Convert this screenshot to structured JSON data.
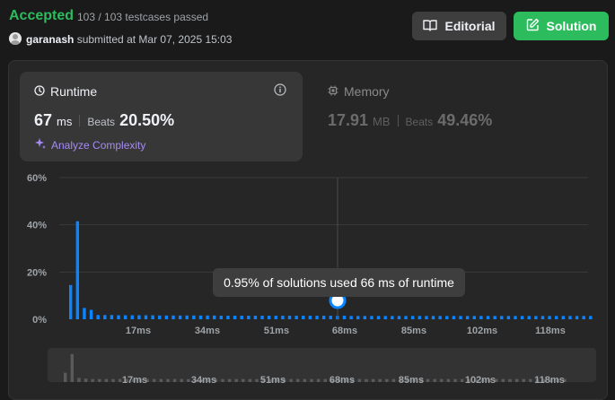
{
  "header": {
    "status": "Accepted",
    "testcases": "103 / 103 testcases passed",
    "username": "garanash",
    "submitted_text": "submitted at Mar 07, 2025 15:03",
    "editorial_label": "Editorial",
    "solution_label": "Solution"
  },
  "runtime": {
    "title": "Runtime",
    "value": "67",
    "unit": "ms",
    "beats_label": "Beats",
    "beats_value": "20.50%",
    "analyze_label": "Analyze Complexity"
  },
  "memory": {
    "title": "Memory",
    "value": "17.91",
    "unit": "MB",
    "beats_label": "Beats",
    "beats_value": "49.46%"
  },
  "tooltip": "0.95% of solutions used 66 ms of runtime",
  "colors": {
    "accepted": "#2cbb5d",
    "bar": "#0a84ff",
    "panel": "#262626",
    "card": "#373737",
    "analyze": "#a48bf5"
  },
  "chart_data": {
    "type": "bar",
    "title": "",
    "xlabel": "",
    "ylabel": "",
    "ylim": [
      0,
      60
    ],
    "yticks": [
      "60%",
      "40%",
      "20%",
      "0%"
    ],
    "xticks": [
      "17ms",
      "34ms",
      "51ms",
      "68ms",
      "85ms",
      "102ms",
      "118ms"
    ],
    "highlight_ms": 66,
    "highlight_percent": 0.95,
    "series": [
      {
        "values": [
          14.5,
          41.5,
          4.8,
          4.0,
          1.8,
          1.8,
          1.8,
          1.7,
          1.7,
          1.7,
          1.7,
          1.7,
          1.7,
          1.6,
          1.6,
          1.6,
          1.6,
          1.6,
          1.6,
          1.6,
          1.6,
          1.6,
          1.5,
          1.5,
          1.5,
          1.5,
          1.5,
          1.5,
          1.5,
          1.5,
          1.5,
          1.5,
          1.5,
          1.5,
          1.5,
          1.5,
          1.5,
          1.5,
          1.5,
          1.5,
          1.5,
          1.4,
          1.4,
          1.4,
          1.4,
          1.4,
          1.4,
          1.4,
          1.4,
          1.4,
          1.4,
          1.4,
          1.4,
          1.4,
          1.4,
          1.4,
          1.4,
          1.4,
          1.4,
          1.4,
          1.4,
          1.4,
          1.4,
          1.4,
          1.4,
          1.4,
          1.4,
          1.4,
          1.4,
          1.4,
          1.4,
          1.4,
          1.4,
          1.4,
          1.4,
          1.4,
          1.4
        ]
      }
    ]
  },
  "range_chart": {
    "values": [
      4.0,
      12.0,
      1.8,
      1.5,
      1.3,
      1.3,
      1.3,
      1.3,
      1.3,
      1.3,
      1.3,
      1.3,
      1.3,
      1.3,
      1.3,
      1.3,
      1.3,
      1.3,
      1.3,
      1.3,
      1.3,
      1.3,
      1.3,
      1.3,
      1.3,
      1.3,
      1.3,
      1.3,
      1.3,
      1.3,
      1.3,
      1.3,
      1.3,
      1.3,
      1.3,
      1.3,
      1.3,
      1.3,
      1.3,
      1.3,
      1.3,
      1.3,
      1.3,
      1.3,
      1.3,
      1.3,
      1.3,
      1.3,
      1.3,
      1.3,
      1.3,
      1.3,
      1.3,
      1.3,
      1.3,
      1.3,
      1.3,
      1.3,
      1.3,
      1.3,
      1.3,
      1.3,
      1.3,
      1.3,
      1.3,
      1.3,
      1.3,
      1.3,
      1.3,
      1.3,
      1.3,
      1.3,
      1.3,
      1.3
    ],
    "xticks": [
      "17ms",
      "34ms",
      "51ms",
      "68ms",
      "85ms",
      "102ms",
      "118ms"
    ]
  }
}
